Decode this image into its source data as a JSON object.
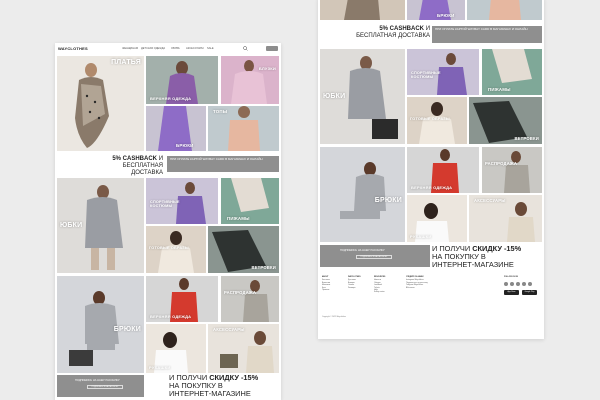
{
  "header": {
    "logo": "WAYCLOTHES",
    "nav": [
      "ЖЕНЩИНАМ",
      "ДЕТСКАЯ ОДЕЖДА",
      "ОБУВЬ",
      "АКСЕССУАРЫ",
      "SALE"
    ]
  },
  "categories": {
    "dresses": "ПЛАТЬЯ",
    "outerwear": "ВЕРХНЯЯ ОДЕЖДА",
    "blouses": "БЛУЗКИ",
    "tops": "ТОПЫ",
    "trousers": "БРЮКИ",
    "skirts": "ЮБКИ",
    "sport": "СПОРТИВНЫЕ КОСТЮМЫ",
    "pajamas": "ПИЖАМЫ",
    "looks": "ГОТОВЫЕ ОБРАЗЫ",
    "sweaters": "СВИТЕРЫ",
    "jackets": "ВЕТРОВКИ",
    "cardigans": "РАСПРОДАЖА",
    "accessories": "АКСЕССУАРЫ",
    "shirts": "РУБАШКИ"
  },
  "promo": {
    "cashback_bold": "5% CASHBACK",
    "cashback_rest": "И",
    "delivery": "БЕСПЛАТНАЯ ДОСТАВКА",
    "card_text": "ПРИ ОПЛАТЕ КАРТОЙ WAYBAY CARD В МАГАЗИНАХ И ОНЛАЙН"
  },
  "subscribe": {
    "label": "ПОДПИШИСЬ НА НАШУ РАССЫЛКУ",
    "button": "ПОДПИСАТЬСЯ НА РАССЫЛКУ"
  },
  "discount": {
    "line1_pre": "И ПОЛУЧИ",
    "line1_bold": "СКИДКУ -15%",
    "line2": "НА ПОКУПКУ В",
    "line3": "ИНТЕРНЕТ-МАГАЗИНЕ"
  },
  "footer": {
    "columns": [
      {
        "title": "ABOUT",
        "items": [
          "Контакты",
          "Вакансии",
          "Магазины",
          "Блог",
          "Правила"
        ]
      },
      {
        "title": "WAYCLOTHES",
        "items": [
          "Доставка",
          "Возврат",
          "Оплата",
          "Размеры"
        ]
      },
      {
        "title": "RESOURCES",
        "items": [
          "Новости",
          "Обзоры",
          "Lookbook",
          "Tickets",
          "Help",
          "Safety center"
        ]
      },
      {
        "title": "СЛЕДИТЕ ЗА НАМИ",
        "items": [
          "Instagram Wayclothes",
          "Подписаться на рассылку",
          "Telegram Wayclothes",
          "ВКонтакте"
        ]
      }
    ],
    "follow": "FOLLOW US ON",
    "app_store": "App Store",
    "google_play": "Google Play",
    "copyright": "Copyright © 2022 Wayclothes"
  },
  "colors": {
    "bg": "#ececec",
    "accent_gray": "#8f8f8f",
    "teal": "#7fa898",
    "purple": "#8e6cc7",
    "pink": "#d9a3c8"
  }
}
